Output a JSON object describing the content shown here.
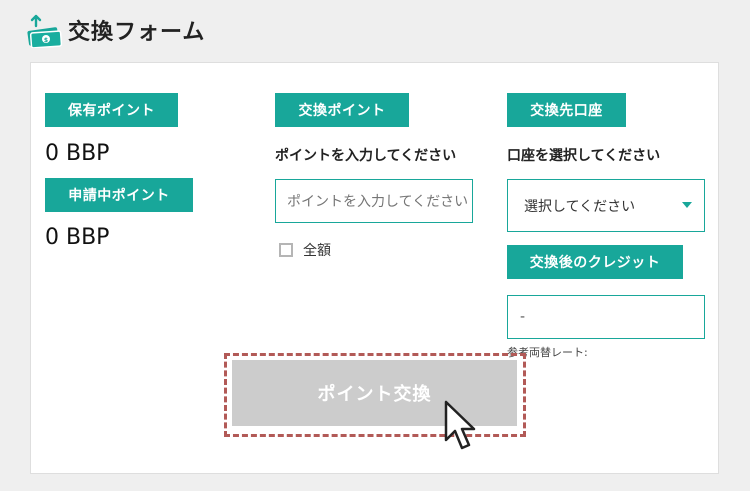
{
  "header": {
    "title": "交換フォーム",
    "icon": "money-exchange-icon"
  },
  "points": {
    "held_label": "保有ポイント",
    "held_value": "0 BBP",
    "pending_label": "申請中ポイント",
    "pending_value": "0 BBP"
  },
  "exchange": {
    "badge": "交換ポイント",
    "instruction": "ポイントを入力してください",
    "input_value": "",
    "input_placeholder": "ポイントを入力してください",
    "all_amount_label": "全額",
    "all_amount_checked": false
  },
  "destination": {
    "badge": "交換先口座",
    "instruction": "口座を選択してください",
    "select_value": "選択してください",
    "arrow_icon": "caret-down-icon"
  },
  "credit": {
    "badge": "交換後のクレジット",
    "value": "-",
    "rate_label": "参考両替レート:"
  },
  "submit": {
    "label": "ポイント交換",
    "enabled": false
  },
  "colors": {
    "accent": "#18a79a",
    "background": "#efefef",
    "disabled_button": "#cccccc",
    "highlight_border": "#b25a57"
  }
}
